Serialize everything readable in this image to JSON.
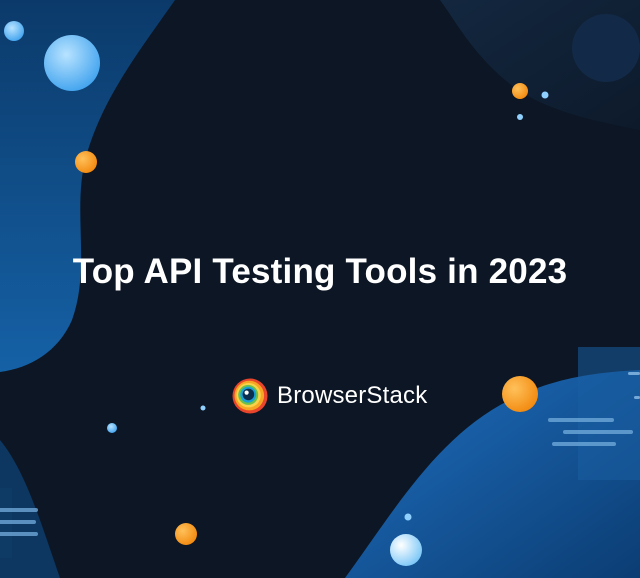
{
  "headline": "Top API Testing Tools in 2023",
  "brand": {
    "name": "BrowserStack",
    "logo_icon": "browserstack-logo-icon"
  },
  "colors": {
    "background": "#0c1624",
    "accent_blue": "#1a5a9c",
    "accent_orange": "#f59a1e",
    "text": "#ffffff"
  }
}
